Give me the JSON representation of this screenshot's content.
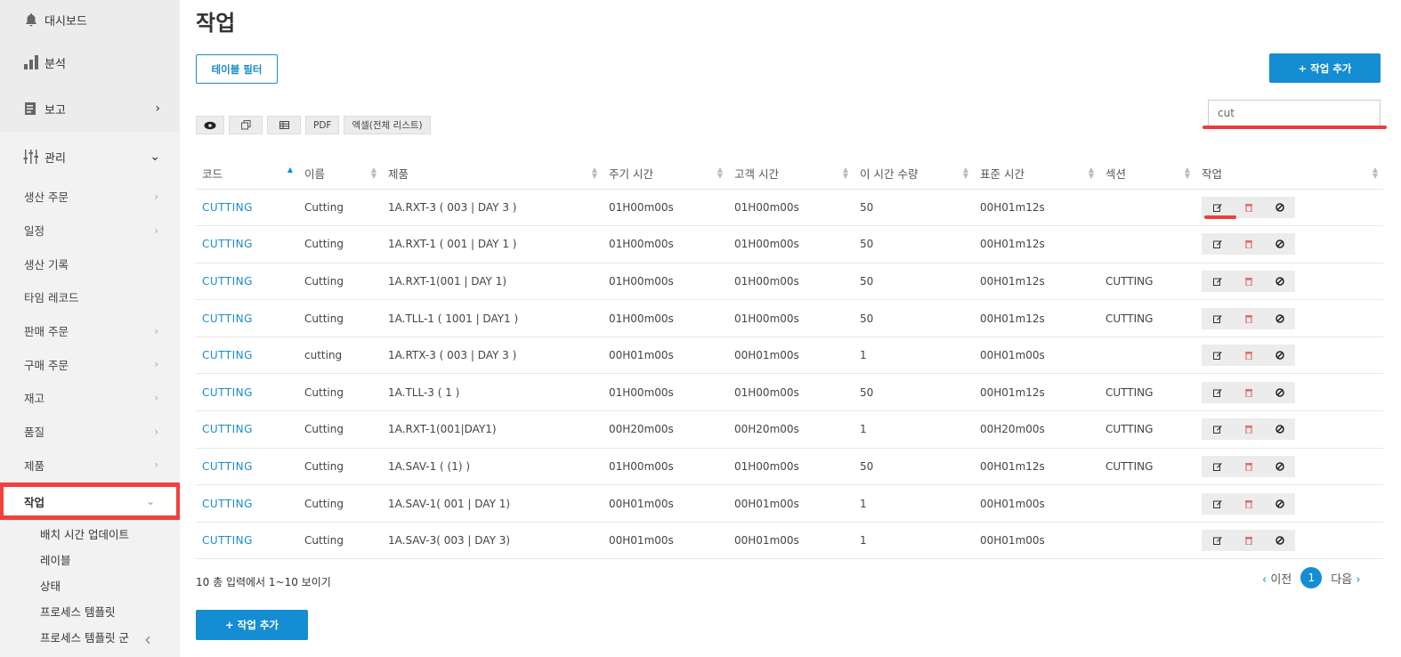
{
  "sidebar": {
    "dashboard": "대시보드",
    "analytics": "분석",
    "reports": "보고",
    "manage": "관리",
    "submenu": [
      {
        "label": "생산 주문",
        "chevron": true
      },
      {
        "label": "일정",
        "chevron": true
      },
      {
        "label": "생산 기록",
        "chevron": false
      },
      {
        "label": "타임 레코드",
        "chevron": false
      },
      {
        "label": "판매 주문",
        "chevron": true
      },
      {
        "label": "구매 주문",
        "chevron": true
      },
      {
        "label": "재고",
        "chevron": true
      },
      {
        "label": "품질",
        "chevron": true
      },
      {
        "label": "제품",
        "chevron": true
      }
    ],
    "active": "작업",
    "children": [
      "배치 시간 업데이트",
      "레이블",
      "상태",
      "프로세스 템플릿",
      "프로세스 템플릿 군"
    ]
  },
  "page": {
    "title": "작업",
    "filter_button": "테이블 필터",
    "add_button": "+ 작업 추가",
    "toolbar_pdf": "PDF",
    "toolbar_excel": "엑셀(전체 리스트)",
    "search_value": "cut"
  },
  "table": {
    "headers": [
      "코드",
      "이름",
      "제품",
      "주기 시간",
      "고객 시간",
      "이 시간 수량",
      "표준 시간",
      "섹션",
      "작업"
    ],
    "rows": [
      [
        "CUTTING",
        "Cutting",
        "1A.RXT-3 ( 003 | DAY 3 )",
        "01H00m00s",
        "01H00m00s",
        "50",
        "00H01m12s",
        ""
      ],
      [
        "CUTTING",
        "Cutting",
        "1A.RXT-1 ( 001 | DAY 1 )",
        "01H00m00s",
        "01H00m00s",
        "50",
        "00H01m12s",
        ""
      ],
      [
        "CUTTING",
        "Cutting",
        "1A.RXT-1(001 | DAY 1)",
        "01H00m00s",
        "01H00m00s",
        "50",
        "00H01m12s",
        "CUTTING"
      ],
      [
        "CUTTING",
        "Cutting",
        "1A.TLL-1 ( 1001 | DAY1 )",
        "01H00m00s",
        "01H00m00s",
        "50",
        "00H01m12s",
        "CUTTING"
      ],
      [
        "CUTTING",
        "cutting",
        "1A.RTX-3 ( 003 | DAY 3 )",
        "00H01m00s",
        "00H01m00s",
        "1",
        "00H01m00s",
        ""
      ],
      [
        "CUTTING",
        "Cutting",
        "1A.TLL-3 ( 1 )",
        "01H00m00s",
        "01H00m00s",
        "50",
        "00H01m12s",
        "CUTTING"
      ],
      [
        "CUTTING",
        "Cutting",
        "1A.RXT-1(001|DAY1)",
        "00H20m00s",
        "00H20m00s",
        "1",
        "00H20m00s",
        "CUTTING"
      ],
      [
        "CUTTING",
        "Cutting",
        "1A.SAV-1 ( (1) )",
        "01H00m00s",
        "01H00m00s",
        "50",
        "00H01m12s",
        "CUTTING"
      ],
      [
        "CUTTING",
        "Cutting",
        "1A.SAV-1( 001 | DAY 1)",
        "00H01m00s",
        "00H01m00s",
        "1",
        "00H01m00s",
        ""
      ],
      [
        "CUTTING",
        "Cutting",
        "1A.SAV-3( 003 | DAY 3)",
        "00H01m00s",
        "00H01m00s",
        "1",
        "00H01m00s",
        ""
      ]
    ]
  },
  "footer": {
    "info": "10 총 입력에서 1~10 보이기",
    "prev": "이전",
    "current": "1",
    "next": "다음"
  },
  "colors": {
    "accent": "#148dd3",
    "highlight": "#ee3b3e",
    "sidebar_bg": "#f2f2f2"
  }
}
